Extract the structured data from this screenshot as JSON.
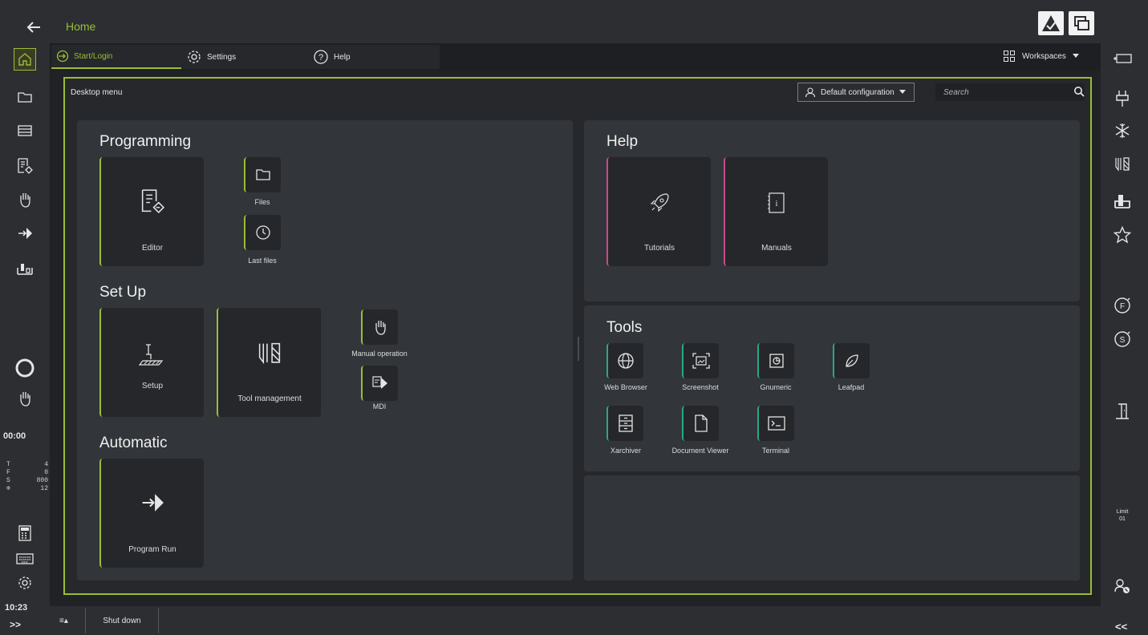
{
  "titlebar": {
    "title": "Home"
  },
  "tabs": [
    {
      "label": "Start/Login",
      "icon": "login-icon"
    },
    {
      "label": "Settings",
      "icon": "gear-icon"
    },
    {
      "label": "Help",
      "icon": "help-circle-icon"
    }
  ],
  "workspaces": {
    "label": "Workspaces"
  },
  "desktop": {
    "label": "Desktop menu",
    "config_label": "Default configuration",
    "search_placeholder": "Search"
  },
  "sections": {
    "programming": {
      "title": "Programming",
      "editor": "Editor",
      "files": "Files",
      "last_files": "Last files"
    },
    "setup": {
      "title": "Set Up",
      "setup": "Setup",
      "tool_management": "Tool management",
      "manual_operation": "Manual operation",
      "mdi": "MDI"
    },
    "automatic": {
      "title": "Automatic",
      "program_run": "Program Run"
    },
    "help": {
      "title": "Help",
      "tutorials": "Tutorials",
      "manuals": "Manuals"
    },
    "tools": {
      "title": "Tools",
      "items": [
        "Web Browser",
        "Screenshot",
        "Gnumeric",
        "Leafpad",
        "Xarchiver",
        "Document Viewer",
        "Terminal"
      ]
    }
  },
  "status": {
    "timer": "00:00",
    "t_label": "T",
    "t_value": "4",
    "f_label": "F",
    "f_value": "0",
    "s_label": "S",
    "s_value": "800",
    "d_value": "12",
    "clock": "10:23",
    "expand": ">>",
    "collapse": "<<"
  },
  "right_sidebar": {
    "limit_label": "Limit",
    "limit_value": "01"
  },
  "bottombar": {
    "menu_toggle": "≡▴",
    "shutdown": "Shut down"
  },
  "colors": {
    "accent": "#9bbd35",
    "help_accent": "#c84a8a",
    "tools_accent": "#2aa58a"
  }
}
